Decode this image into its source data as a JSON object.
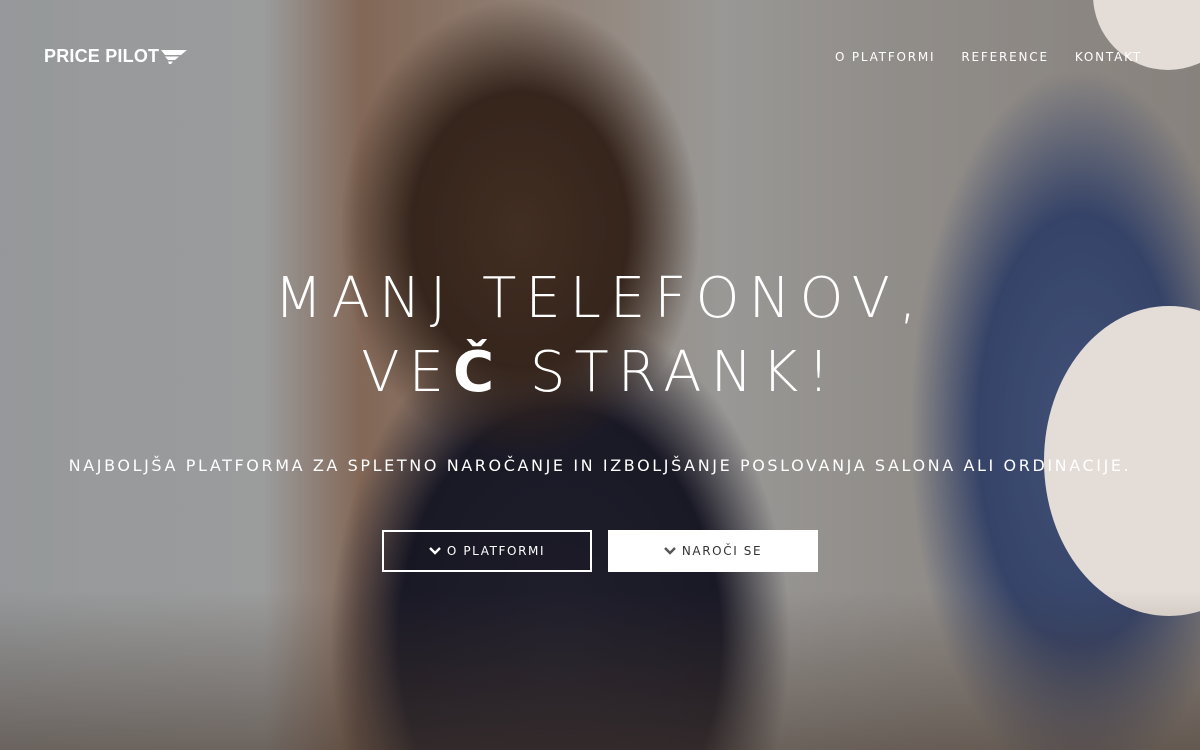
{
  "brand": {
    "name": "PRICE PILOT",
    "logo_icon": "wing-chevron-icon"
  },
  "nav": {
    "items": [
      {
        "label": "O PLATFORMI"
      },
      {
        "label": "REFERENCE"
      },
      {
        "label": "KONTAKT"
      }
    ]
  },
  "hero": {
    "headline_line1": "MANJ TELEFONOV,",
    "headline_line2_prefix": "VE",
    "headline_line2_emphasis": "Č",
    "headline_line2_suffix": " STRANK!",
    "subtitle": "NAJBOLJŠA PLATFORMA ZA SPLETNO NAROČANJE IN IZBOLJŠANJE POSLOVANJA SALONA ALI ORDINACIJE.",
    "buttons": [
      {
        "label": "O PLATFORMI",
        "icon": "chevron-down-icon",
        "style": "outline"
      },
      {
        "label": "NAROČI SE",
        "icon": "chevron-down-icon",
        "style": "solid"
      }
    ]
  },
  "colors": {
    "text": "#ffffff",
    "button_solid_bg": "#ffffff",
    "button_solid_text": "#333333",
    "deco_circle": "#e4dcd6"
  }
}
